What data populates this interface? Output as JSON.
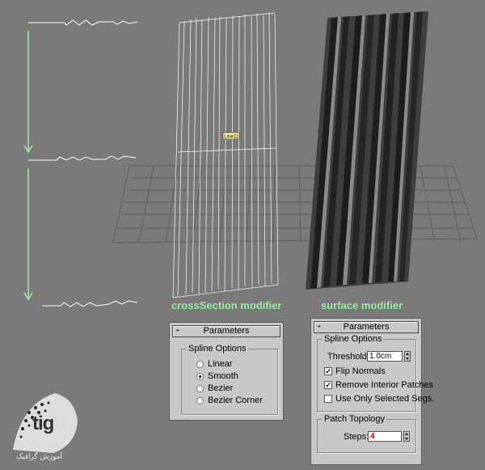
{
  "captions": {
    "left": "crossSection modifier",
    "right": "surface modifier"
  },
  "spline_label": "Line11",
  "watermark": {
    "logo_text": "tig",
    "subtitle": "آموزش گرافیک"
  },
  "left_panel": {
    "rollout_title": "Parameters",
    "group_label": "Spline Options",
    "options": [
      "Linear",
      "Smooth",
      "Bezier",
      "Bezier Corner"
    ],
    "selected": "Smooth"
  },
  "right_panel": {
    "rollout_title": "Parameters",
    "spline_group_label": "Spline Options",
    "threshold_label": "Threshold:",
    "threshold_value": "1.0cm",
    "checkboxes": [
      {
        "label": "Flip Normals",
        "checked": true
      },
      {
        "label": "Remove Interior Patches",
        "checked": true
      },
      {
        "label": "Use Only Selected Segs.",
        "checked": false
      }
    ],
    "patch_group_label": "Patch Topology",
    "steps_label": "Steps:",
    "steps_value": "4"
  },
  "colors": {
    "viewport_bg": "#7a7a7a",
    "grid": "#5e5e5e",
    "spline": "#ffffff",
    "arrow": "#9ff0a8",
    "caption": "#9ff0a8",
    "panel_bg": "#c8c8c8"
  }
}
